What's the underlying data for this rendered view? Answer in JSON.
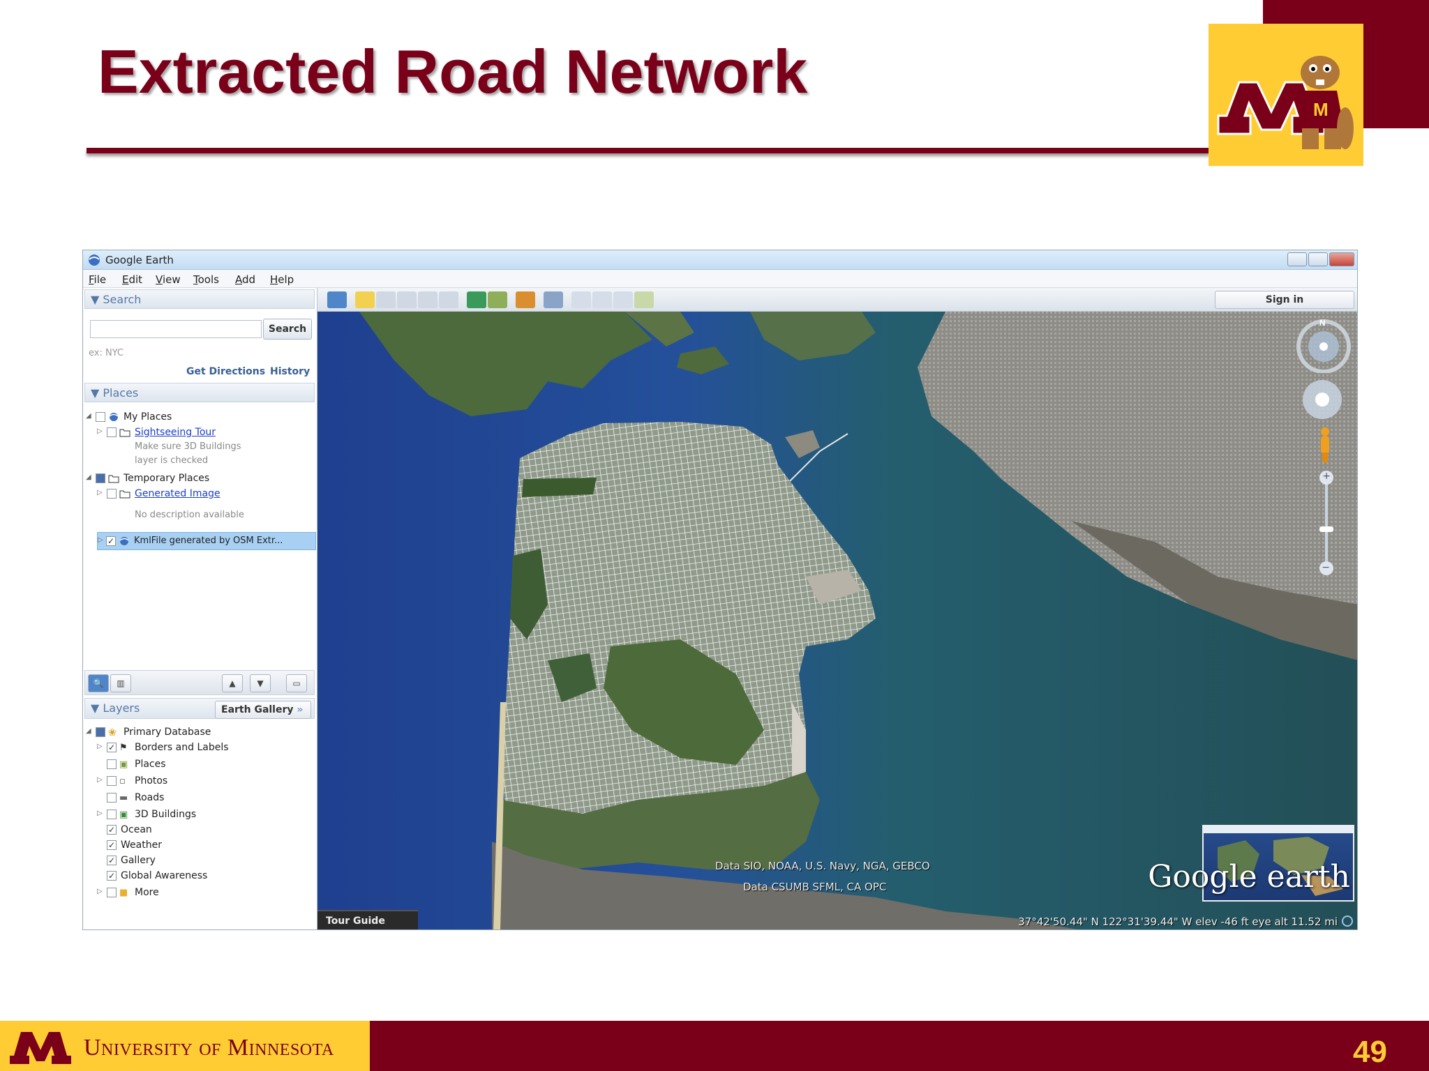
{
  "slide": {
    "title": "Extracted Road Network",
    "footer_university": "University of Minnesota",
    "page_number": "49",
    "brand_colors": {
      "maroon": "#7a0019",
      "gold": "#ffcc33"
    }
  },
  "window": {
    "title": "Google Earth",
    "menu": [
      "File",
      "Edit",
      "View",
      "Tools",
      "Add",
      "Help"
    ]
  },
  "search_panel": {
    "header": "Search",
    "button": "Search",
    "hint": "ex: NYC",
    "get_directions": "Get Directions",
    "history": "History"
  },
  "places_panel": {
    "header": "Places",
    "my_places": "My Places",
    "sightseeing_tour": "Sightseeing Tour",
    "sightseeing_note_1": "Make sure 3D Buildings",
    "sightseeing_note_2": "layer is checked",
    "temporary_places": "Temporary Places",
    "generated_image": "Generated Image",
    "generated_note": "No description available",
    "kml_file": "KmlFile generated by OSM Extr..."
  },
  "layers_panel": {
    "header": "Layers",
    "earth_gallery": "Earth Gallery",
    "primary_database": "Primary Database",
    "items": [
      {
        "label": "Borders and Labels",
        "checked": true
      },
      {
        "label": "Places",
        "checked": false
      },
      {
        "label": "Photos",
        "checked": false
      },
      {
        "label": "Roads",
        "checked": false
      },
      {
        "label": "3D Buildings",
        "checked": false
      },
      {
        "label": "Ocean",
        "checked": true
      },
      {
        "label": "Weather",
        "checked": true
      },
      {
        "label": "Gallery",
        "checked": true
      },
      {
        "label": "Global Awareness",
        "checked": true
      },
      {
        "label": "More",
        "checked": false
      }
    ]
  },
  "toolbar": {
    "sign_in": "Sign in"
  },
  "map": {
    "attribution_1": "Data SIO, NOAA, U.S. Navy, NGA, GEBCO",
    "attribution_2": "Data CSUMB SFML, CA OPC",
    "tour_guide": "Tour Guide",
    "status": "37°42'50.44\" N  122°31'39.44\" W  elev   -46 ft     eye alt  11.52 mi",
    "brand_text": "Google earth"
  },
  "icons": [
    "globe-icon",
    "folder-icon",
    "compass-icon",
    "pegman-icon",
    "zoom-plus-icon",
    "zoom-minus-icon"
  ]
}
